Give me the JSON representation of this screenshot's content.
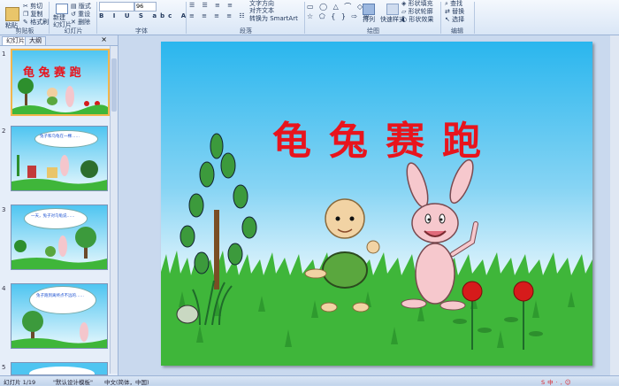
{
  "ribbon": {
    "clipboard": {
      "paste": "粘贴",
      "cut": "剪切",
      "copy": "复制",
      "format_painter": "格式刷",
      "label": "剪贴板"
    },
    "slides": {
      "new_slide": "新建\n幻灯片",
      "layout": "版式",
      "reset": "重设",
      "delete": "删除",
      "label": "幻灯片"
    },
    "font": {
      "size": "96",
      "label": "字体"
    },
    "paragraph": {
      "text_direction": "文字方向",
      "align_text": "对齐文本",
      "smartart": "转换为 SmartArt",
      "label": "段落"
    },
    "drawing": {
      "arrange": "排列",
      "quick_styles": "快速样式",
      "shape_fill": "形状填充",
      "shape_outline": "形状轮廓",
      "shape_effects": "形状效果",
      "label": "绘图"
    },
    "editing": {
      "find": "查找",
      "replace": "替换",
      "select": "选择",
      "label": "编辑"
    }
  },
  "panel": {
    "tabs": [
      "幻灯片",
      "大纲"
    ]
  },
  "thumbnails": [
    {
      "num": "1",
      "title": "龟 兔 赛 跑"
    },
    {
      "num": "2",
      "text": "兔子和乌龟在一棵……"
    },
    {
      "num": "3",
      "text": "一天，兔子对乌龟说……"
    },
    {
      "num": "4",
      "text": "兔子跑到离终点不远的……"
    },
    {
      "num": "5",
      "text": ""
    }
  ],
  "slide": {
    "title": "龟兔赛跑"
  },
  "status": {
    "slide_pos": "幻灯片 1/19",
    "theme": "\"默认设计模板\"",
    "language": "中文(简体，中国)"
  },
  "colors": {
    "title_red": "#e8141d",
    "sky_top": "#2ab6ee",
    "grass": "#3fb63a"
  }
}
